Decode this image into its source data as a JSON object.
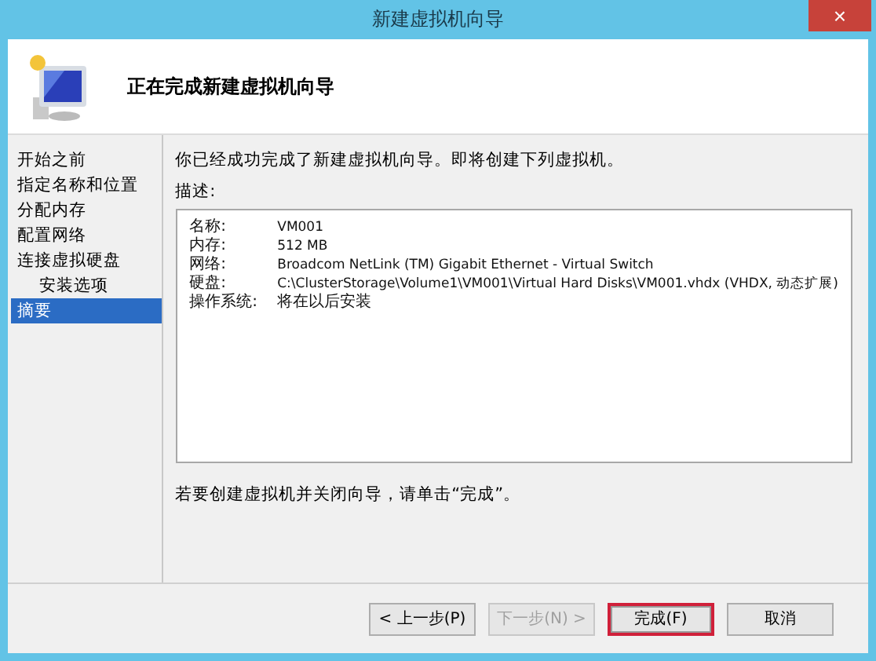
{
  "window": {
    "title": "新建虚拟机向导",
    "close": "×"
  },
  "header": {
    "title": "正在完成新建虚拟机向导"
  },
  "sidebar": {
    "items": [
      {
        "label": "开始之前",
        "selected": false
      },
      {
        "label": "指定名称和位置",
        "selected": false
      },
      {
        "label": "分配内存",
        "selected": false
      },
      {
        "label": "配置网络",
        "selected": false
      },
      {
        "label": "连接虚拟硬盘",
        "selected": false,
        "children": [
          {
            "label": "安装选项",
            "selected": false
          }
        ]
      },
      {
        "label": "摘要",
        "selected": true
      }
    ]
  },
  "content": {
    "intro": "你已经成功完成了新建虚拟机向导。即将创建下列虚拟机。",
    "description_label": "描述:",
    "details": [
      {
        "name": "名称:",
        "value": "VM001"
      },
      {
        "name": "内存:",
        "value": "512 MB"
      },
      {
        "name": "网络:",
        "value": "Broadcom NetLink (TM) Gigabit Ethernet - Virtual Switch"
      },
      {
        "name": "硬盘:",
        "value": "C:\\ClusterStorage\\Volume1\\VM001\\Virtual Hard Disks\\VM001.vhdx (VHDX, 动态扩展)"
      },
      {
        "name": "操作系统:",
        "value": "将在以后安装"
      }
    ],
    "footer_note": "若要创建虚拟机并关闭向导，请单击“完成”。"
  },
  "buttons": [
    {
      "label": "< 上一步(P)",
      "disabled": false,
      "highlighted": false
    },
    {
      "label": "下一步(N) >",
      "disabled": true,
      "highlighted": false
    },
    {
      "label": "完成(F)",
      "disabled": false,
      "highlighted": true
    },
    {
      "label": "取消",
      "disabled": false,
      "highlighted": false
    }
  ]
}
